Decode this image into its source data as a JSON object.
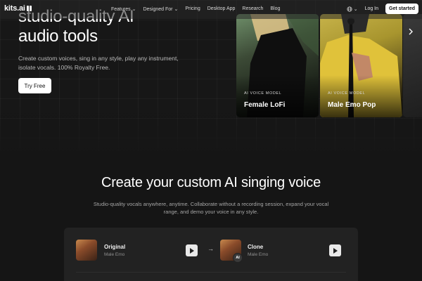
{
  "nav": {
    "logo_text": "kits.ai",
    "links": [
      "Features",
      "Designed For",
      "Pricing",
      "Desktop App",
      "Research",
      "Blog"
    ],
    "login_label": "Log In",
    "get_started_label": "Get started"
  },
  "hero": {
    "title_line1": "studio-quality AI",
    "title_line2": "audio tools",
    "subtitle": "Create custom voices, sing in any style, play any instrument, isolate vocals. 100% Royalty Free.",
    "cta_label": "Try Free"
  },
  "voice_cards": [
    {
      "tag": "AI VOICE MODEL",
      "name": "Female LoFi"
    },
    {
      "tag": "AI VOICE MODEL",
      "name": "Male Emo Pop"
    }
  ],
  "section": {
    "title": "Create your custom AI singing voice",
    "subtitle": "Studio-quality vocals anywhere, anytime. Collaborate without a recording session, expand your vocal range, and demo your voice in any style."
  },
  "demo": {
    "original": {
      "title": "Original",
      "meta": "Male Emo"
    },
    "clone": {
      "title": "Clone",
      "meta": "Male Emo",
      "badge": "AI"
    }
  }
}
